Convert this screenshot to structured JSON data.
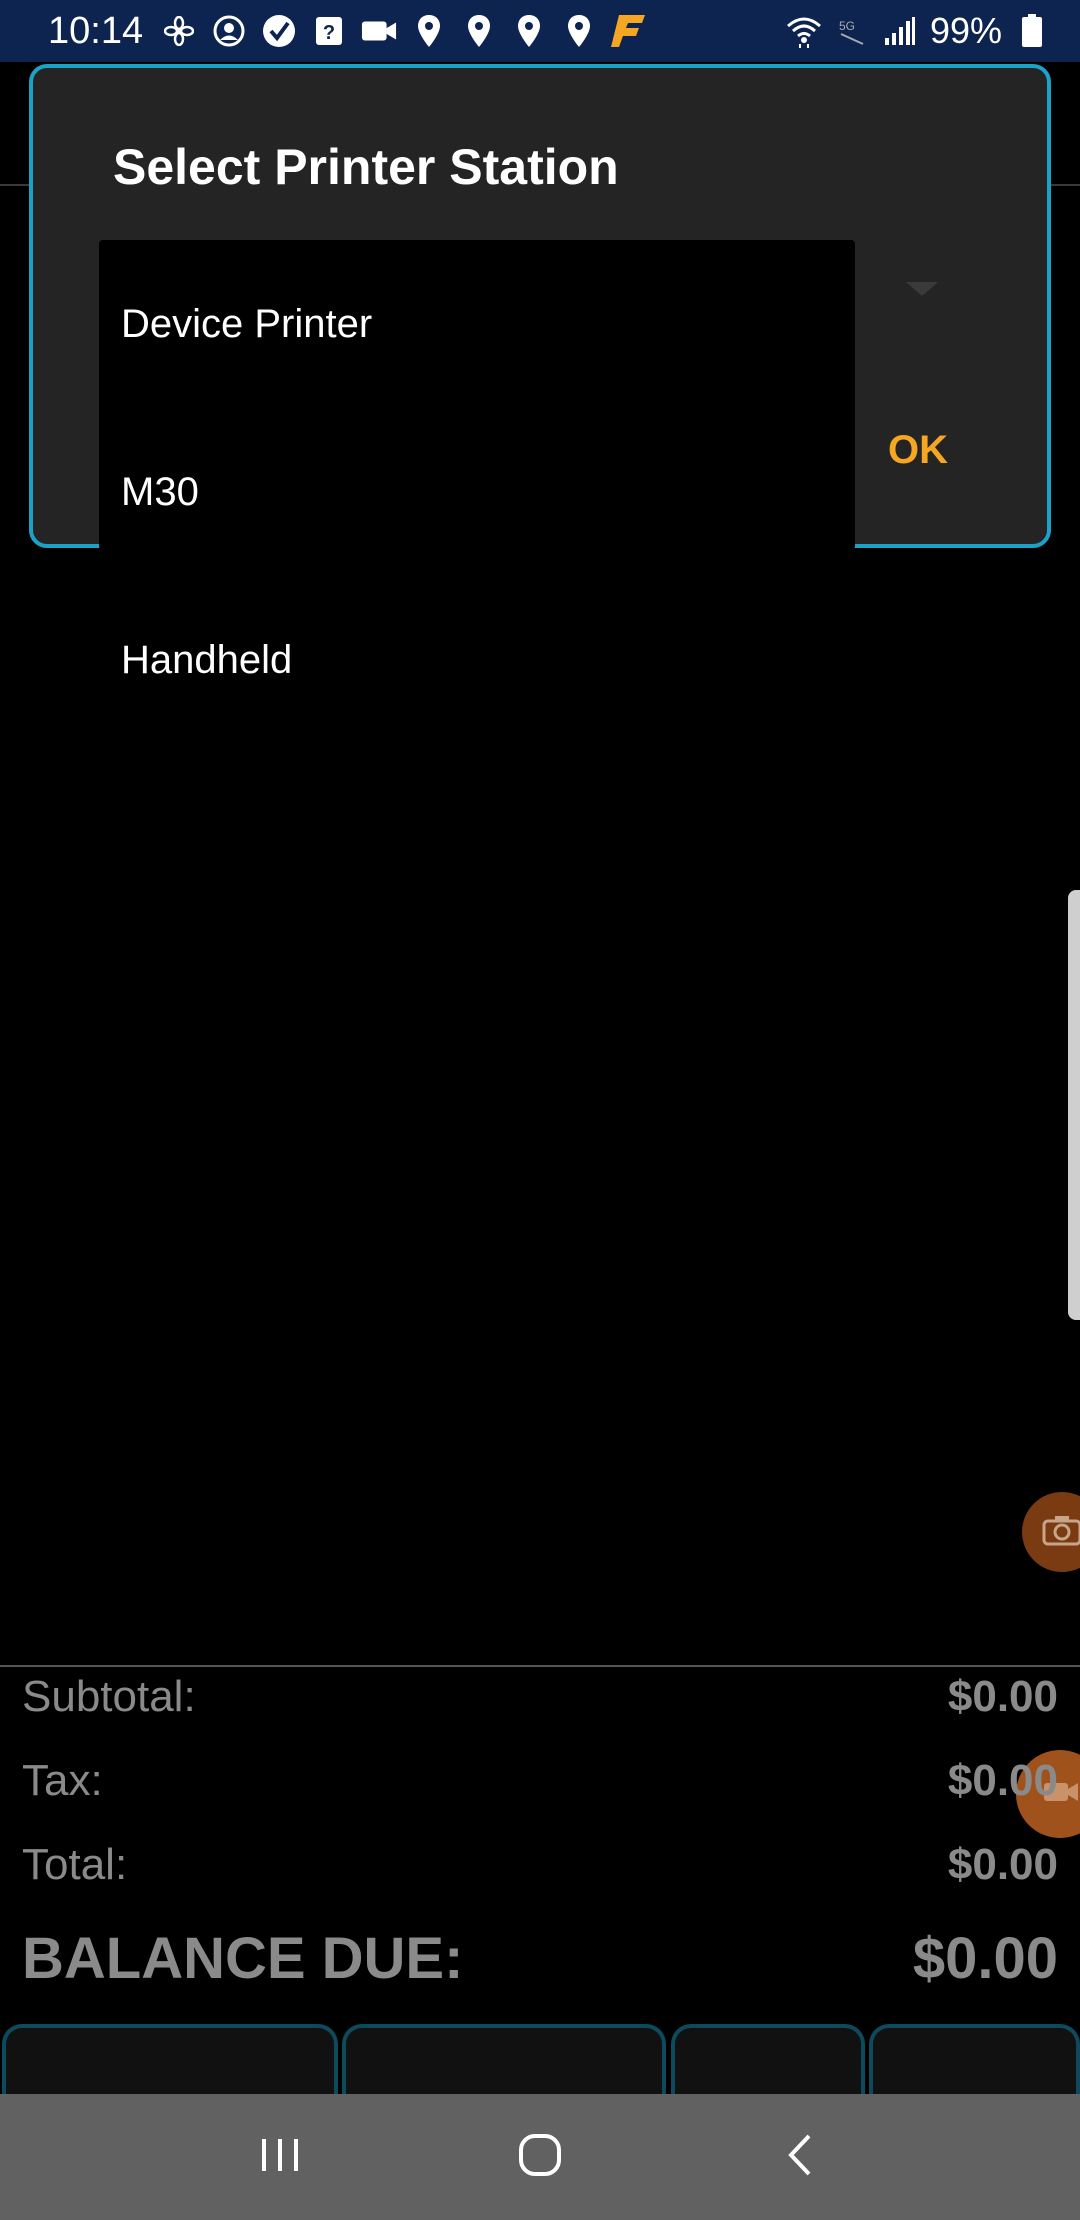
{
  "status_bar": {
    "time": "10:14",
    "battery": "99%",
    "icons": [
      "fan-icon",
      "account-icon",
      "check-badge-icon",
      "help-box-icon",
      "video-camera-icon",
      "location-pin-icon",
      "location-pin-icon",
      "location-pin-icon",
      "location-pin-icon",
      "f-logo-icon"
    ],
    "right_icons": [
      "wifi-icon",
      "5g-icon",
      "signal-icon",
      "battery-icon"
    ]
  },
  "dialog": {
    "title": "Select Printer Station",
    "ok_label": "OK",
    "accent": "#1aa3c7",
    "ok_color": "#f5a623"
  },
  "dropdown": {
    "items": [
      {
        "label": "Device Printer"
      },
      {
        "label": "M30"
      },
      {
        "label": "Handheld"
      }
    ]
  },
  "totals": {
    "subtotal_label": "Subtotal:",
    "subtotal_value": "$0.00",
    "tax_label": "Tax:",
    "tax_value": "$0.00",
    "total_label": "Total:",
    "total_value": "$0.00",
    "balance_label": "BALANCE DUE:",
    "balance_value": "$0.00"
  },
  "nav": {
    "icons": [
      "recent-apps-icon",
      "home-icon",
      "back-icon"
    ]
  }
}
